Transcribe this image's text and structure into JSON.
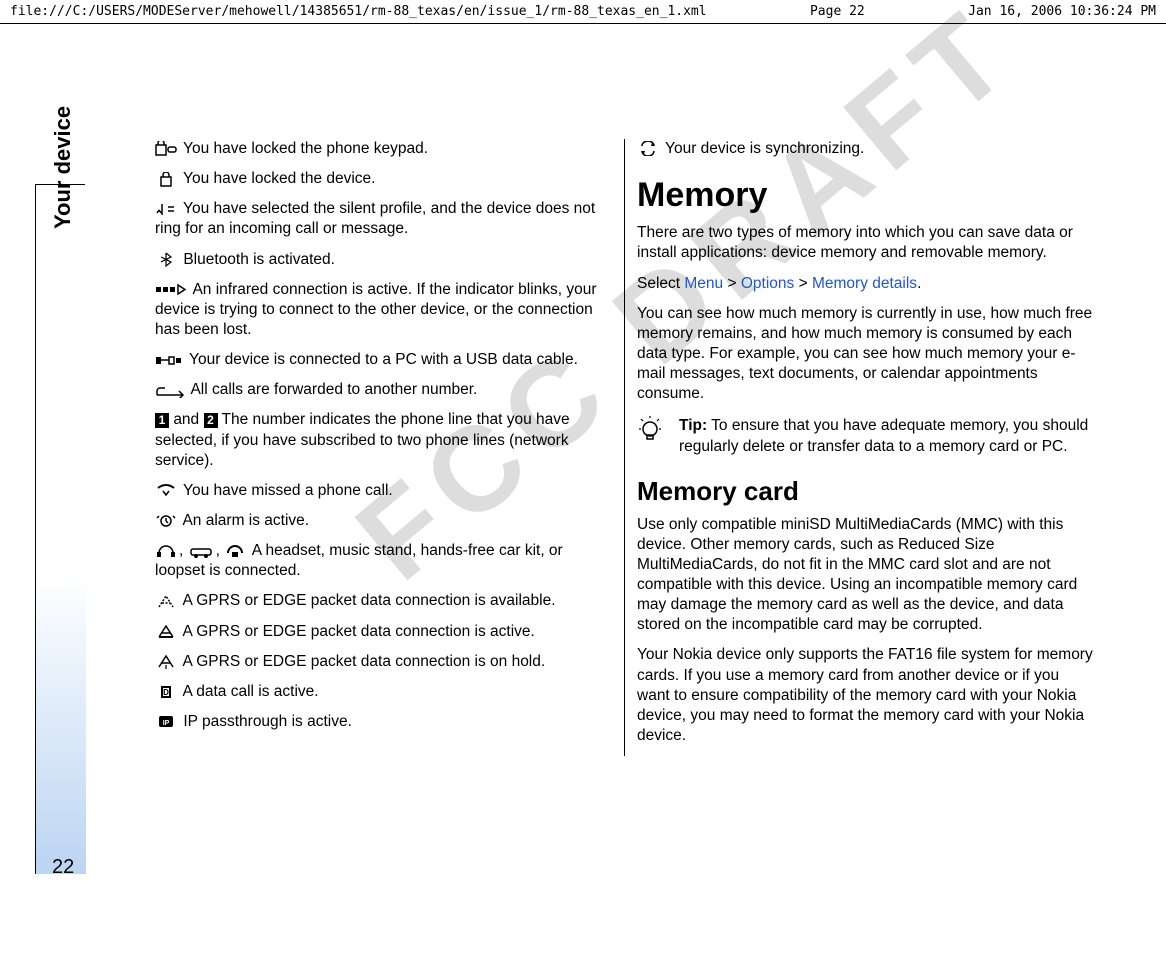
{
  "header": {
    "path": "file:///C:/USERS/MODEServer/mehowell/14385651/rm-88_texas/en/issue_1/rm-88_texas_en_1.xml",
    "page": "Page 22",
    "date": "Jan 16, 2006 10:36:24 PM"
  },
  "sidebar": {
    "label": "Your device",
    "page_number": "22"
  },
  "watermark": "FCC DRAFT",
  "left": {
    "keypad_locked": "You have locked the phone keypad.",
    "device_locked": "You have locked the device.",
    "silent_profile": "You have selected the silent profile, and the device does not ring for an incoming call or message.",
    "bluetooth": "Bluetooth is activated.",
    "infrared": "An infrared connection is active. If the indicator blinks, your device is trying to connect to the other device, or the connection has been lost.",
    "usb": "Your device is connected to a PC with a USB data cable.",
    "forward": "All calls are forwarded to another number.",
    "line_and": "and",
    "line_text": "The number indicates the phone line that you have selected, if you have subscribed to two phone lines (network service).",
    "missed_call": "You have missed a phone call.",
    "alarm": "An alarm is active.",
    "headset": "A headset, music stand, hands-free car kit, or loopset is connected.",
    "gprs_avail": "A GPRS or EDGE packet data connection is available.",
    "gprs_active": "A GPRS or EDGE packet data connection is active.",
    "gprs_hold": "A GPRS or EDGE packet data connection is on hold.",
    "data_call": "A data call is active.",
    "ip_pass": "IP passthrough is active."
  },
  "right": {
    "sync": "Your device is synchronizing.",
    "memory_heading": "Memory",
    "memory_para": "There are two types of memory into which you can save data or install applications: device memory and removable memory.",
    "select_pre": "Select ",
    "menu": "Menu",
    "gt": ">",
    "options": "Options",
    "memory_details": "Memory details",
    "period": ".",
    "memory_para2": "You can see how much memory is currently in use, how much free memory remains, and how much memory is consumed by each data type. For example, you can see how much memory your e-mail messages, text documents, or calendar appointments consume.",
    "tip_label": "Tip:",
    "tip_text": "To ensure that you have adequate memory, you should regularly delete or transfer data to a memory card or PC.",
    "memory_card_heading": "Memory card",
    "memory_card_para1": "Use only compatible miniSD MultiMediaCards (MMC) with this device. Other memory cards, such as Reduced Size MultiMediaCards, do not fit in the MMC card slot and are not compatible with this device. Using an incompatible memory card may damage the memory card as well as the device, and data stored on the incompatible card may be corrupted.",
    "memory_card_para2": "Your Nokia device only supports the FAT16 file system for memory cards. If you use a memory card from another device or if you want to ensure compatibility of the memory card with your Nokia device, you may need to format the memory card with your Nokia device."
  }
}
